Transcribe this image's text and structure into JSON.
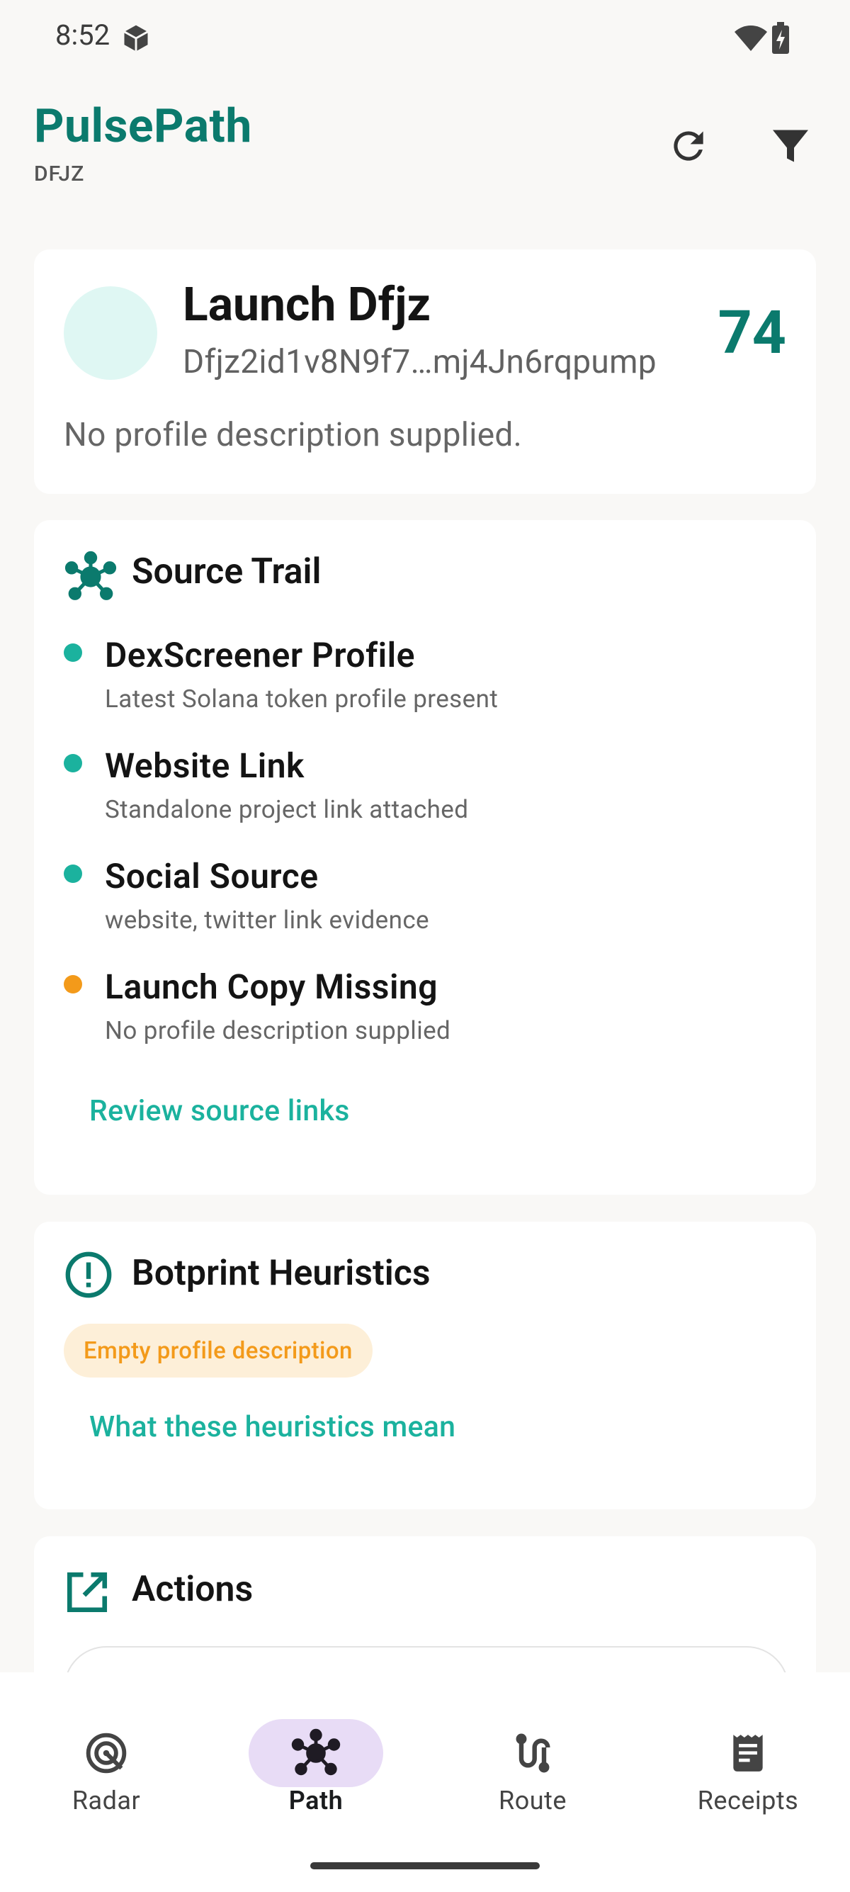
{
  "status_bar": {
    "time": "8:52"
  },
  "header": {
    "title": "PulsePath",
    "subtitle": "DFJZ"
  },
  "profile": {
    "name": "Launch Dfjz",
    "address": "Dfjz2id1v8N9f7…mj4Jn6rqpump",
    "score": "74",
    "description": "No profile description supplied."
  },
  "source_trail": {
    "title": "Source Trail",
    "items": [
      {
        "title": "DexScreener Profile",
        "subtitle": "Latest Solana token profile present",
        "status_color": "#1bb29e"
      },
      {
        "title": "Website Link",
        "subtitle": "Standalone project link attached",
        "status_color": "#1bb29e"
      },
      {
        "title": "Social Source",
        "subtitle": "website, twitter link evidence",
        "status_color": "#1bb29e"
      },
      {
        "title": "Launch Copy Missing",
        "subtitle": "No profile description supplied",
        "status_color": "#f39a1a"
      }
    ],
    "link_label": "Review source links"
  },
  "heuristics": {
    "title": "Botprint Heuristics",
    "chips": [
      "Empty profile description"
    ],
    "link_label": "What these heuristics mean"
  },
  "actions": {
    "title": "Actions"
  },
  "bottom_nav": {
    "items": [
      {
        "label": "Radar",
        "icon": "radar-icon"
      },
      {
        "label": "Path",
        "icon": "hub-icon",
        "active": true
      },
      {
        "label": "Route",
        "icon": "route-icon"
      },
      {
        "label": "Receipts",
        "icon": "receipt-icon"
      }
    ]
  },
  "colors": {
    "accent": "#0b7a6d",
    "teal": "#1bb29e",
    "warning": "#f39a1a",
    "active_nav": "#e8dcf6"
  }
}
